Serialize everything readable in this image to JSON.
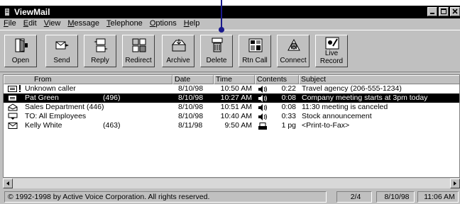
{
  "window": {
    "title": "ViewMail"
  },
  "menu": [
    {
      "label": "File",
      "ul": "F",
      "rest": "ile"
    },
    {
      "label": "Edit",
      "ul": "E",
      "rest": "dit"
    },
    {
      "label": "View",
      "ul": "V",
      "rest": "iew"
    },
    {
      "label": "Message",
      "ul": "M",
      "rest": "essage"
    },
    {
      "label": "Telephone",
      "ul": "T",
      "rest": "elephone"
    },
    {
      "label": "Options",
      "ul": "O",
      "rest": "ptions"
    },
    {
      "label": "Help",
      "ul": "H",
      "rest": "elp"
    }
  ],
  "toolbar": {
    "open": "Open",
    "send": "Send",
    "reply": "Reply",
    "redirect": "Redirect",
    "archive": "Archive",
    "delete": "Delete",
    "rtn_call": "Rtn Call",
    "connect": "Connect",
    "live_record_1": "Live",
    "live_record_2": "Record"
  },
  "columns": {
    "from": "From",
    "date": "Date",
    "time": "Time",
    "contents": "Contents",
    "subject": "Subject"
  },
  "messages": [
    {
      "from": "Unknown caller",
      "ext": "",
      "date": "8/10/98",
      "time": "10:50 AM",
      "contents": "0:22",
      "subject": "Travel agency (206-555-1234)",
      "icon": "new-urgent-icon",
      "ctype": "voice"
    },
    {
      "from": "Pat Green",
      "ext": "(496)",
      "date": "8/10/98",
      "time": "10:27 AM",
      "contents": "0:08",
      "subject": "Company meeting starts at 3pm today",
      "icon": "new-urgent-icon",
      "ctype": "voice"
    },
    {
      "from": "Sales Department (446)",
      "ext": "",
      "date": "8/10/98",
      "time": "10:51 AM",
      "contents": "0:08",
      "subject": "11:30 meeting is canceled",
      "icon": "open-envelope-icon",
      "ctype": "voice"
    },
    {
      "from": "TO: All Employees",
      "ext": "",
      "date": "8/10/98",
      "time": "10:40 AM",
      "contents": "0:33",
      "subject": "Stock announcement",
      "icon": "sent-icon",
      "ctype": "voice"
    },
    {
      "from": "Kelly White",
      "ext": "(463)",
      "date": "8/11/98",
      "time": "9:50 AM",
      "contents": "1 pg",
      "subject": "<Print-to-Fax>",
      "icon": "envelope-icon",
      "ctype": "fax"
    }
  ],
  "status": {
    "copyright": "© 1992-1998 by Active Voice Corporation. All rights reserved.",
    "position": "2/4",
    "date": "8/10/98",
    "time": "11:06 AM"
  }
}
